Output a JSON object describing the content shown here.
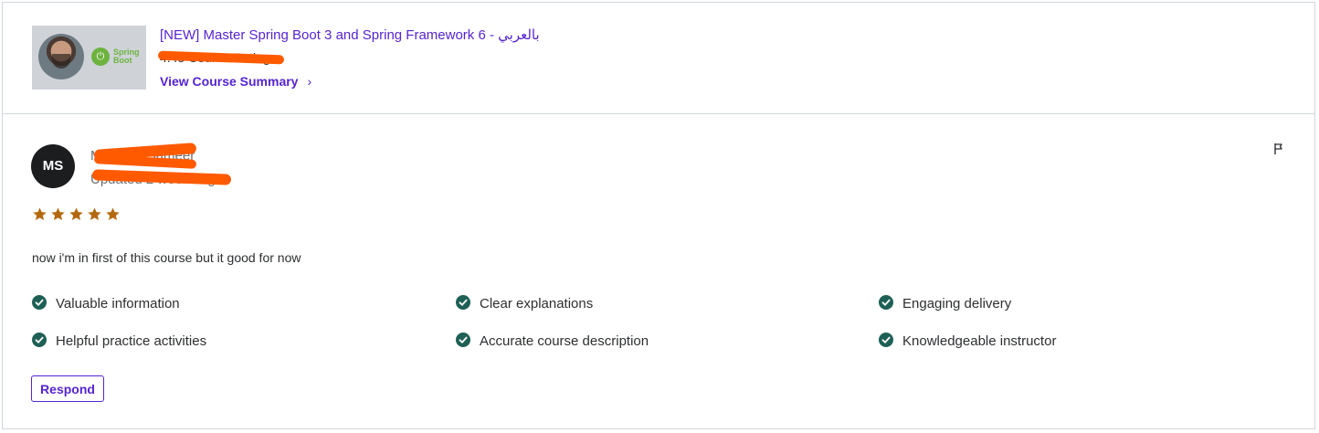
{
  "course": {
    "title": "[NEW] Master Spring Boot 3 and Spring Framework 6 - بالعربي",
    "rating_text": "4.45 Course Rating",
    "summary_link": "View Course Summary",
    "summary_chevron": "›",
    "thumbnail_badge": "Spring Boot"
  },
  "review": {
    "avatar_initials": "MS",
    "reviewer_name": "Muntasir Sameer",
    "date_text": "Updated 2 weeks ago",
    "rating": 5,
    "max_rating": 5,
    "star_color": "#b4690e",
    "text": "now i'm in first of this course but it good for now",
    "tags": [
      "Valuable information",
      "Clear explanations",
      "Engaging delivery",
      "Helpful practice activities",
      "Accurate course description",
      "Knowledgeable instructor"
    ],
    "check_color": "#1e6055",
    "respond_label": "Respond"
  },
  "colors": {
    "accent": "#5624d0",
    "redaction": "#ff5a00"
  }
}
